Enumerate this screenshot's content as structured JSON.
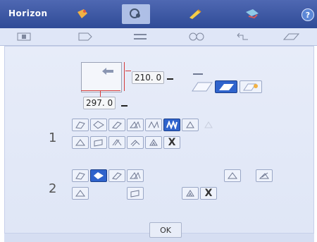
{
  "header": {
    "app_name": "Horizon",
    "help_label": "?",
    "accent_color": "#2f4b97"
  },
  "dimensions": {
    "height_value": "210. 0",
    "width_value": "297. 0"
  },
  "rows": [
    {
      "label": "1",
      "x_label": "X"
    },
    {
      "label": "2",
      "x_label": "X"
    }
  ],
  "footer": {
    "ok_label": "OK"
  }
}
